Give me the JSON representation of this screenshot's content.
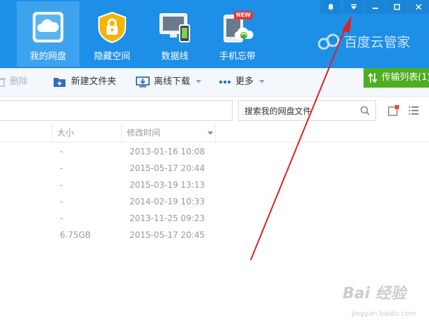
{
  "nav": [
    {
      "label": "我的网盘",
      "icon": "cloud-drive-icon"
    },
    {
      "label": "隐藏空间",
      "icon": "lock-shield-icon"
    },
    {
      "label": "数据线",
      "icon": "devices-sync-icon"
    },
    {
      "label": "手机忘带",
      "icon": "phone-cloud-icon",
      "badge": "NEW"
    }
  ],
  "window_controls": [
    "bell-icon",
    "dropdown-menu-icon",
    "minimize-icon",
    "maximize-icon"
  ],
  "brand": {
    "name": "百度云管家"
  },
  "toolbar": {
    "delete_label": "删除",
    "new_folder_label": "新建文件夹",
    "offline_download_label": "离线下载",
    "more_label": "更多",
    "transfer_list_label": "传输列表(1)"
  },
  "search": {
    "placeholder": "搜索我的网盘文件",
    "value": ""
  },
  "table": {
    "headers": {
      "size": "大小",
      "modified": "修改时间"
    },
    "rows": [
      {
        "size": "-",
        "modified": "2013-01-16 10:08"
      },
      {
        "size": "-",
        "modified": "2015-05-17 20:44"
      },
      {
        "size": "-",
        "modified": "2015-03-19 13:13"
      },
      {
        "size": "-",
        "modified": "2014-02-19 10:33"
      },
      {
        "size": "-",
        "modified": "2013-11-25 09:23"
      },
      {
        "size": "6.75GB",
        "modified": "2015-05-17 20:45"
      }
    ]
  },
  "watermark": {
    "main": "Bai 经验",
    "sub": "jingyan.baidu.com"
  },
  "colors": {
    "header": "#1e8fe6",
    "active_tab": "#3ea3ef",
    "transfer_button": "#4caf1e",
    "annotation_arrow": "#e02020"
  }
}
